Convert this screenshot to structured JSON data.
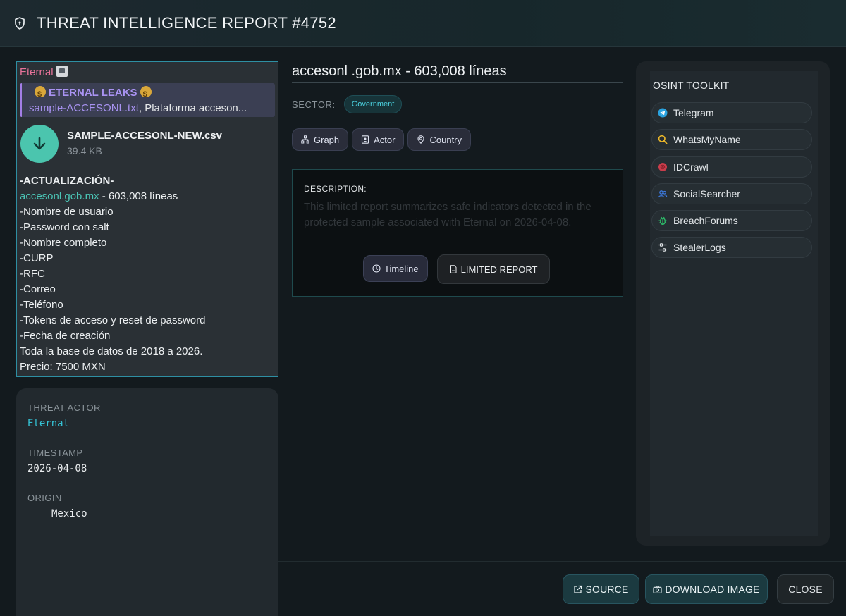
{
  "header": {
    "title": "THREAT INTELLIGENCE REPORT #4752",
    "icon": "shield-icon"
  },
  "message": {
    "author": "Eternal",
    "reply": {
      "title": "ETERNAL LEAKS",
      "file_link": "sample-ACCESONL.txt",
      "preview": ", Plataforma acceson..."
    },
    "file": {
      "name": "SAMPLE-ACCESONL-NEW.csv",
      "size": "39.4 KB"
    },
    "lines": {
      "update": "-ACTUALIZACIÓN-",
      "domain": "accesonl.gob.mx",
      "count": " - 603,008 líneas",
      "f1": "-Nombre de usuario",
      "f2": "-Password con salt",
      "f3": "-Nombre completo",
      "f4": "-CURP",
      "f5": "-RFC",
      "f6": "-Correo",
      "f7": "-Teléfono",
      "f8": "-Tokens de acceso y reset de password",
      "f9": "-Fecha de creación",
      "f10": "Toda la base de datos de 2018 a 2026.",
      "f11": "Precio: 7500 MXN"
    }
  },
  "details": {
    "actor_label": "THREAT ACTOR",
    "actor": "Eternal",
    "timestamp_label": "TIMESTAMP",
    "timestamp": "2026-04-08",
    "origin_label": "ORIGIN",
    "origin": "Mexico"
  },
  "report": {
    "title": "accesonl .gob.mx - 603,008 líneas",
    "sector_label": "SECTOR:",
    "sector": "Government",
    "chips": {
      "graph": "Graph",
      "actor": "Actor",
      "country": "Country"
    },
    "description_label": "DESCRIPTION:",
    "description": "This limited report summarizes safe indicators detected in the protected sample associated with Eternal on 2026-04-08.",
    "timeline": "Timeline",
    "limited": "LIMITED REPORT"
  },
  "osint": {
    "title": "OSINT TOOLKIT",
    "tools": {
      "t1": "Telegram",
      "t2": "WhatsMyName",
      "t3": "IDCrawl",
      "t4": "SocialSearcher",
      "t5": "BreachForums",
      "t6": "StealerLogs"
    }
  },
  "footer": {
    "source": "SOURCE",
    "download": "DOWNLOAD IMAGE",
    "close": "CLOSE"
  },
  "colors": {
    "accent": "#35c3d6",
    "link": "#4bc5b6",
    "author": "#e8739a",
    "reply_accent": "#a993f2"
  }
}
